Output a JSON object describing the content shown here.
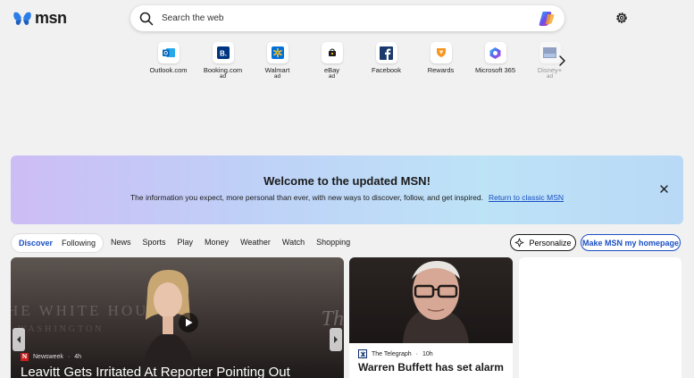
{
  "header": {
    "logo_text": "msn",
    "search_placeholder": "Search the web"
  },
  "quick_links": [
    {
      "label": "Outlook.com",
      "ad": "",
      "icon": "outlook-icon"
    },
    {
      "label": "Booking.com",
      "ad": "ad",
      "icon": "booking-icon"
    },
    {
      "label": "Walmart",
      "ad": "ad",
      "icon": "walmart-icon"
    },
    {
      "label": "eBay",
      "ad": "ad",
      "icon": "ebay-icon"
    },
    {
      "label": "Facebook",
      "ad": "",
      "icon": "facebook-icon"
    },
    {
      "label": "Rewards",
      "ad": "",
      "icon": "rewards-icon"
    },
    {
      "label": "Microsoft 365",
      "ad": "",
      "icon": "microsoft365-icon"
    },
    {
      "label": "Disney+",
      "ad": "ad",
      "icon": "disney-icon"
    }
  ],
  "banner": {
    "title": "Welcome to the updated MSN!",
    "text": "The information you expect, more personal than ever, with new ways to discover, follow, and get inspired.",
    "link": "Return to classic MSN"
  },
  "feed_toggle": {
    "discover": "Discover",
    "following": "Following"
  },
  "nav": [
    "News",
    "Sports",
    "Play",
    "Money",
    "Weather",
    "Watch",
    "Shopping"
  ],
  "buttons": {
    "personalize": "Personalize",
    "homepage": "Make MSN my homepage"
  },
  "cards": {
    "main": {
      "source": "Newsweek",
      "time": "4h",
      "headline": "Leavitt Gets Irritated At Reporter Pointing Out",
      "bg_text_1": "HE WHITE HOUSE",
      "bg_text_2": "WASHINGTON",
      "bg_text_3": "Th"
    },
    "second": {
      "source": "The Telegraph",
      "time": "10h",
      "headline": "Warren Buffett has set alarm"
    }
  },
  "colors": {
    "accent": "#1a4fc4",
    "background": "#f1f1f1"
  }
}
